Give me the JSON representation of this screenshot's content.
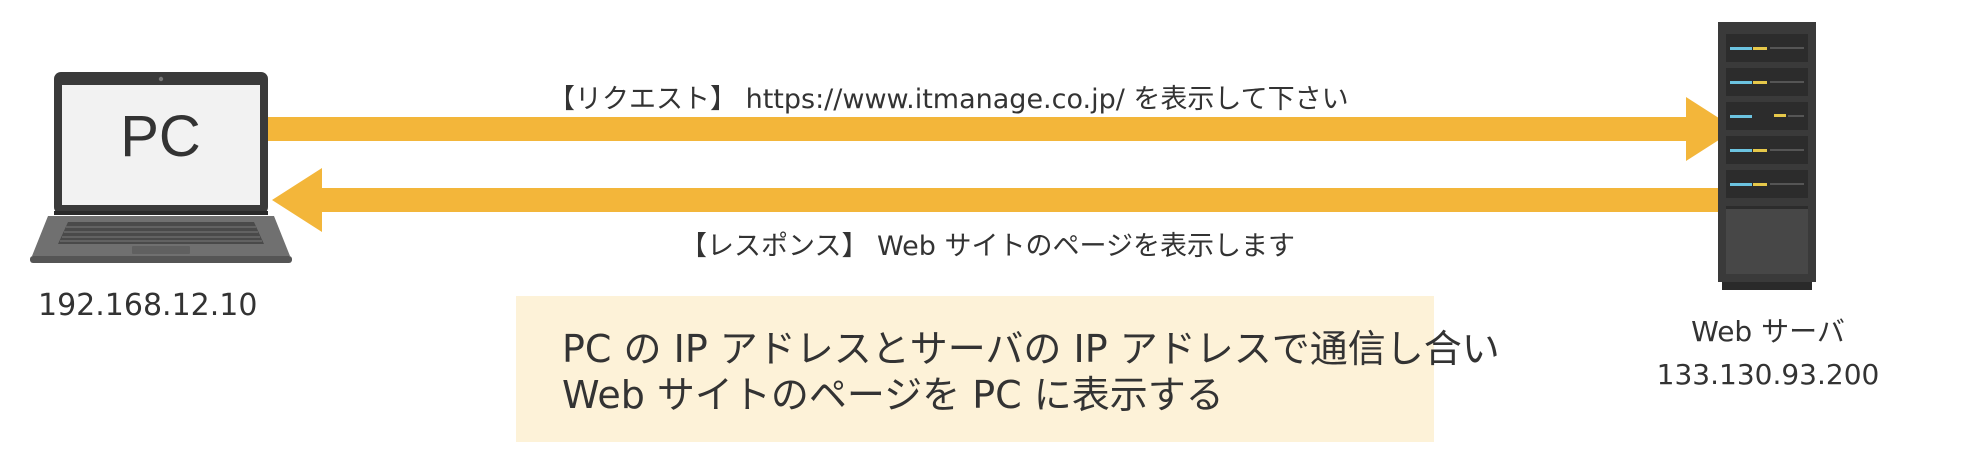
{
  "pc": {
    "screen_text": "PC",
    "ip": "192.168.12.10"
  },
  "request_arrow": {
    "label": "【リクエスト】 https://www.itmanage.co.jp/ を表示して下さい"
  },
  "response_arrow": {
    "label": "【レスポンス】 Web サイトのページを表示します"
  },
  "server": {
    "name": "Web サーバ",
    "ip": "133.130.93.200"
  },
  "info_box": {
    "line1": "PC の IP アドレスとサーバの IP アドレスで通信し合い",
    "line2": "Web サイトのページを PC に表示する"
  },
  "colors": {
    "arrow": "#f3b63a",
    "info_bg": "#fdf2d8",
    "device_dark": "#3a3a3a"
  }
}
